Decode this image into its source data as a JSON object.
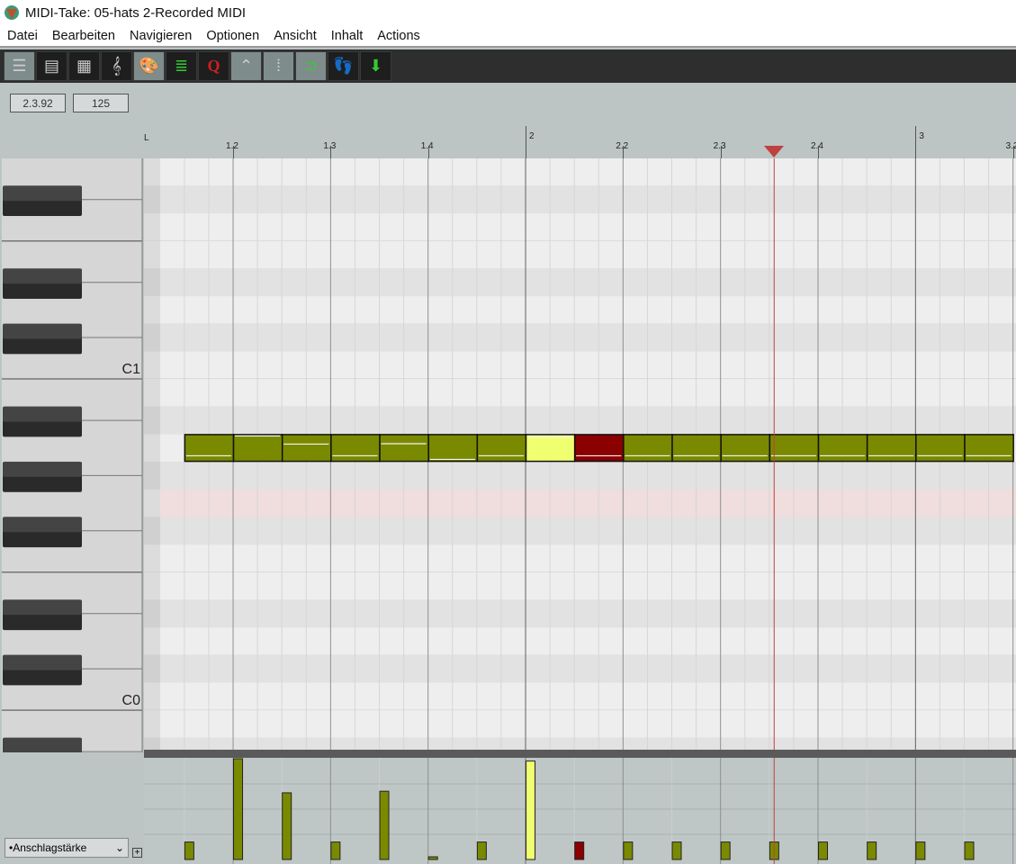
{
  "window": {
    "title": "MIDI-Take: 05-hats 2-Recorded MIDI"
  },
  "menu": [
    "Datei",
    "Bearbeiten",
    "Navigieren",
    "Optionen",
    "Ansicht",
    "Inhalt",
    "Actions"
  ],
  "toolbar": {
    "buttons": [
      {
        "icon": "piano-roll-icon",
        "active": true
      },
      {
        "icon": "named-notes-icon",
        "active": false
      },
      {
        "icon": "drum-grid-icon",
        "active": false
      },
      {
        "icon": "treble-clef-icon",
        "active": false
      },
      {
        "icon": "color-palette-icon",
        "active": true
      },
      {
        "icon": "event-list-icon",
        "active": false
      },
      {
        "icon": "quantize-icon",
        "active": false
      },
      {
        "icon": "cc-envelope-icon",
        "active": true
      },
      {
        "icon": "grid-dots-icon",
        "active": true
      },
      {
        "icon": "snap-magnet-icon",
        "active": true
      },
      {
        "icon": "step-record-icon",
        "active": false
      },
      {
        "icon": "midi-input-icon",
        "active": false
      }
    ]
  },
  "fields": {
    "position": "2.3.92",
    "velocity": "125"
  },
  "ruler": {
    "labels": [
      {
        "text": "1.2",
        "beat": 1
      },
      {
        "text": "1.3",
        "beat": 2
      },
      {
        "text": "1.4",
        "beat": 3
      },
      {
        "text": "2",
        "beat": 4
      },
      {
        "text": "2.2",
        "beat": 5
      },
      {
        "text": "2.3",
        "beat": 6
      },
      {
        "text": "2.4",
        "beat": 7
      },
      {
        "text": "3",
        "beat": 8
      },
      {
        "text": "3.2",
        "beat": 9
      }
    ],
    "loop_marker": "L",
    "playhead_beat": 6.55
  },
  "keyboard": {
    "labels": [
      "C1",
      "C0"
    ]
  },
  "colors": {
    "note": "#7a8a00",
    "note_selected": "#f0ff70",
    "note_muted_red": "#8b0000",
    "playhead": "#c04040",
    "highlight_row": "#f0d8d8"
  },
  "notes": [
    {
      "pitch": "A0",
      "start_beat": 0.5,
      "length": 0.5,
      "velocity": 22,
      "state": "normal"
    },
    {
      "pitch": "A0",
      "start_beat": 1.0,
      "length": 0.5,
      "velocity": 127,
      "state": "normal"
    },
    {
      "pitch": "A0",
      "start_beat": 1.5,
      "length": 0.5,
      "velocity": 84,
      "state": "normal"
    },
    {
      "pitch": "A0",
      "start_beat": 2.0,
      "length": 0.5,
      "velocity": 22,
      "state": "normal"
    },
    {
      "pitch": "A0",
      "start_beat": 2.5,
      "length": 0.5,
      "velocity": 86,
      "state": "normal"
    },
    {
      "pitch": "A0",
      "start_beat": 3.0,
      "length": 0.5,
      "velocity": 3,
      "state": "normal"
    },
    {
      "pitch": "A0",
      "start_beat": 3.5,
      "length": 0.5,
      "velocity": 22,
      "state": "normal"
    },
    {
      "pitch": "A0",
      "start_beat": 4.0,
      "length": 0.5,
      "velocity": 124,
      "state": "selected"
    },
    {
      "pitch": "A0",
      "start_beat": 4.5,
      "length": 0.5,
      "velocity": 22,
      "state": "red"
    },
    {
      "pitch": "A0",
      "start_beat": 5.0,
      "length": 0.5,
      "velocity": 22,
      "state": "normal"
    },
    {
      "pitch": "A0",
      "start_beat": 5.5,
      "length": 0.5,
      "velocity": 22,
      "state": "normal"
    },
    {
      "pitch": "A0",
      "start_beat": 6.0,
      "length": 0.5,
      "velocity": 22,
      "state": "normal"
    },
    {
      "pitch": "A0",
      "start_beat": 6.5,
      "length": 0.5,
      "velocity": 22,
      "state": "normal"
    },
    {
      "pitch": "A0",
      "start_beat": 7.0,
      "length": 0.5,
      "velocity": 22,
      "state": "normal"
    },
    {
      "pitch": "A0",
      "start_beat": 7.5,
      "length": 0.5,
      "velocity": 22,
      "state": "normal"
    },
    {
      "pitch": "A0",
      "start_beat": 8.0,
      "length": 0.5,
      "velocity": 22,
      "state": "normal"
    },
    {
      "pitch": "A0",
      "start_beat": 8.5,
      "length": 0.5,
      "velocity": 22,
      "state": "normal"
    }
  ],
  "lane": {
    "selected": "•Anschlagstärke",
    "add_label": "+"
  }
}
